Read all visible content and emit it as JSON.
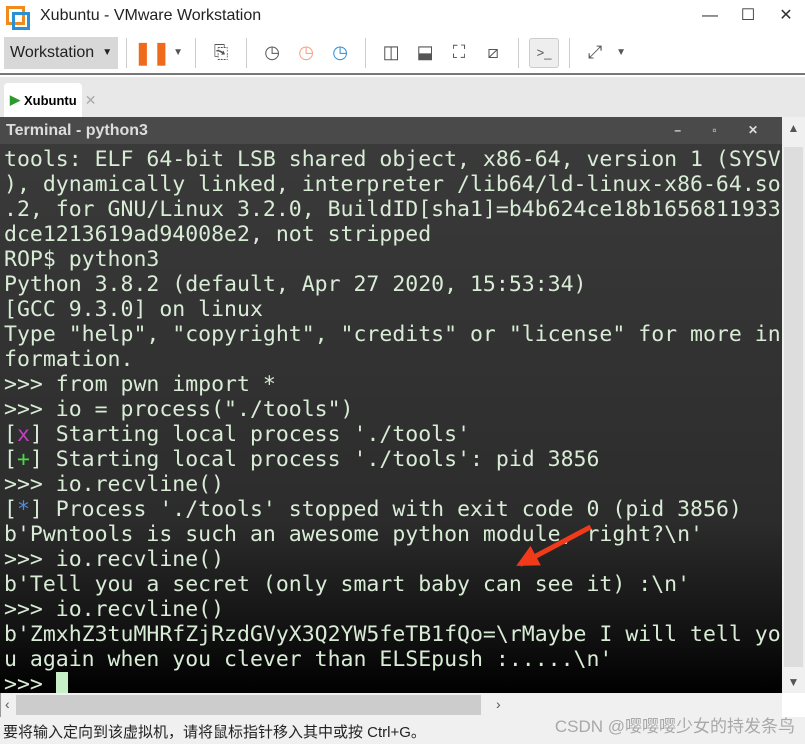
{
  "window": {
    "title": "Xubuntu - VMware Workstation",
    "minimize": "—",
    "maximize": "☐",
    "close": "✕"
  },
  "toolbar": {
    "workstation_menu": "Workstation",
    "dropdown": "▼"
  },
  "tab": {
    "label": "Xubuntu",
    "close": "✕"
  },
  "terminal": {
    "title": "Terminal - python3",
    "controls": "– ▫ ✕",
    "lines": [
      "tools: ELF 64-bit LSB shared object, x86-64, version 1 (SYSV",
      "), dynamically linked, interpreter /lib64/ld-linux-x86-64.so",
      ".2, for GNU/Linux 3.2.0, BuildID[sha1]=b4b624ce18b1656811933",
      "dce1213619ad94008e2, not stripped",
      "ROP$ python3",
      "Python 3.8.2 (default, Apr 27 2020, 15:53:34)",
      "[GCC 9.3.0] on linux",
      "Type \"help\", \"copyright\", \"credits\" or \"license\" for more in",
      "formation.",
      ">>> from pwn import *",
      ">>> io = process(\"./tools\")",
      "Starting local process './tools'",
      "Starting local process './tools': pid 3856",
      ">>> io.recvline()",
      "Process './tools' stopped with exit code 0 (pid 3856)",
      "b'Pwntools is such an awesome python module, right?\\n'",
      ">>> io.recvline()",
      "b'Tell you a secret (only smart baby can see it) :\\n'",
      ">>> io.recvline()",
      "b'ZmxhZ3tuMHRfZjRzdGVyX3Q2YW5feTB1fQo=\\rMaybe I will tell yo",
      "u again when you clever than ELSEpush :.....\\n'",
      ">>> "
    ],
    "markers": {
      "x": "x",
      "plus": "+",
      "star": "*"
    }
  },
  "status": {
    "text": "要将输入定向到该虚拟机，请将鼠标指针移入其中或按 Ctrl+G。",
    "watermark": "CSDN @嘤嘤嘤少女的持发条鸟"
  },
  "colors": {
    "accent_orange": "#f06a1c",
    "terminal_text": "#d8ecd6",
    "annotation_arrow": "#f03a1a"
  }
}
